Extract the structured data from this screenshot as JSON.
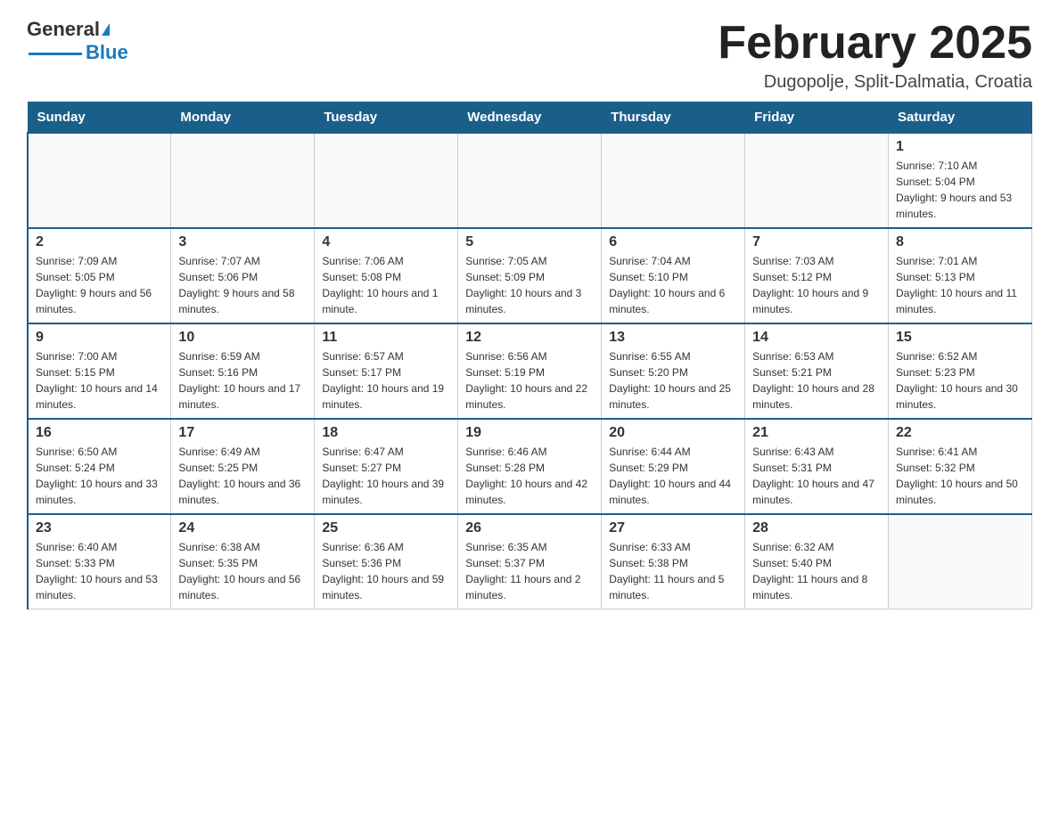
{
  "header": {
    "logo_general": "General",
    "logo_blue": "Blue",
    "month_title": "February 2025",
    "location": "Dugopolje, Split-Dalmatia, Croatia"
  },
  "days_of_week": [
    "Sunday",
    "Monday",
    "Tuesday",
    "Wednesday",
    "Thursday",
    "Friday",
    "Saturday"
  ],
  "weeks": [
    [
      {
        "day": "",
        "info": ""
      },
      {
        "day": "",
        "info": ""
      },
      {
        "day": "",
        "info": ""
      },
      {
        "day": "",
        "info": ""
      },
      {
        "day": "",
        "info": ""
      },
      {
        "day": "",
        "info": ""
      },
      {
        "day": "1",
        "info": "Sunrise: 7:10 AM\nSunset: 5:04 PM\nDaylight: 9 hours and 53 minutes."
      }
    ],
    [
      {
        "day": "2",
        "info": "Sunrise: 7:09 AM\nSunset: 5:05 PM\nDaylight: 9 hours and 56 minutes."
      },
      {
        "day": "3",
        "info": "Sunrise: 7:07 AM\nSunset: 5:06 PM\nDaylight: 9 hours and 58 minutes."
      },
      {
        "day": "4",
        "info": "Sunrise: 7:06 AM\nSunset: 5:08 PM\nDaylight: 10 hours and 1 minute."
      },
      {
        "day": "5",
        "info": "Sunrise: 7:05 AM\nSunset: 5:09 PM\nDaylight: 10 hours and 3 minutes."
      },
      {
        "day": "6",
        "info": "Sunrise: 7:04 AM\nSunset: 5:10 PM\nDaylight: 10 hours and 6 minutes."
      },
      {
        "day": "7",
        "info": "Sunrise: 7:03 AM\nSunset: 5:12 PM\nDaylight: 10 hours and 9 minutes."
      },
      {
        "day": "8",
        "info": "Sunrise: 7:01 AM\nSunset: 5:13 PM\nDaylight: 10 hours and 11 minutes."
      }
    ],
    [
      {
        "day": "9",
        "info": "Sunrise: 7:00 AM\nSunset: 5:15 PM\nDaylight: 10 hours and 14 minutes."
      },
      {
        "day": "10",
        "info": "Sunrise: 6:59 AM\nSunset: 5:16 PM\nDaylight: 10 hours and 17 minutes."
      },
      {
        "day": "11",
        "info": "Sunrise: 6:57 AM\nSunset: 5:17 PM\nDaylight: 10 hours and 19 minutes."
      },
      {
        "day": "12",
        "info": "Sunrise: 6:56 AM\nSunset: 5:19 PM\nDaylight: 10 hours and 22 minutes."
      },
      {
        "day": "13",
        "info": "Sunrise: 6:55 AM\nSunset: 5:20 PM\nDaylight: 10 hours and 25 minutes."
      },
      {
        "day": "14",
        "info": "Sunrise: 6:53 AM\nSunset: 5:21 PM\nDaylight: 10 hours and 28 minutes."
      },
      {
        "day": "15",
        "info": "Sunrise: 6:52 AM\nSunset: 5:23 PM\nDaylight: 10 hours and 30 minutes."
      }
    ],
    [
      {
        "day": "16",
        "info": "Sunrise: 6:50 AM\nSunset: 5:24 PM\nDaylight: 10 hours and 33 minutes."
      },
      {
        "day": "17",
        "info": "Sunrise: 6:49 AM\nSunset: 5:25 PM\nDaylight: 10 hours and 36 minutes."
      },
      {
        "day": "18",
        "info": "Sunrise: 6:47 AM\nSunset: 5:27 PM\nDaylight: 10 hours and 39 minutes."
      },
      {
        "day": "19",
        "info": "Sunrise: 6:46 AM\nSunset: 5:28 PM\nDaylight: 10 hours and 42 minutes."
      },
      {
        "day": "20",
        "info": "Sunrise: 6:44 AM\nSunset: 5:29 PM\nDaylight: 10 hours and 44 minutes."
      },
      {
        "day": "21",
        "info": "Sunrise: 6:43 AM\nSunset: 5:31 PM\nDaylight: 10 hours and 47 minutes."
      },
      {
        "day": "22",
        "info": "Sunrise: 6:41 AM\nSunset: 5:32 PM\nDaylight: 10 hours and 50 minutes."
      }
    ],
    [
      {
        "day": "23",
        "info": "Sunrise: 6:40 AM\nSunset: 5:33 PM\nDaylight: 10 hours and 53 minutes."
      },
      {
        "day": "24",
        "info": "Sunrise: 6:38 AM\nSunset: 5:35 PM\nDaylight: 10 hours and 56 minutes."
      },
      {
        "day": "25",
        "info": "Sunrise: 6:36 AM\nSunset: 5:36 PM\nDaylight: 10 hours and 59 minutes."
      },
      {
        "day": "26",
        "info": "Sunrise: 6:35 AM\nSunset: 5:37 PM\nDaylight: 11 hours and 2 minutes."
      },
      {
        "day": "27",
        "info": "Sunrise: 6:33 AM\nSunset: 5:38 PM\nDaylight: 11 hours and 5 minutes."
      },
      {
        "day": "28",
        "info": "Sunrise: 6:32 AM\nSunset: 5:40 PM\nDaylight: 11 hours and 8 minutes."
      },
      {
        "day": "",
        "info": ""
      }
    ]
  ]
}
